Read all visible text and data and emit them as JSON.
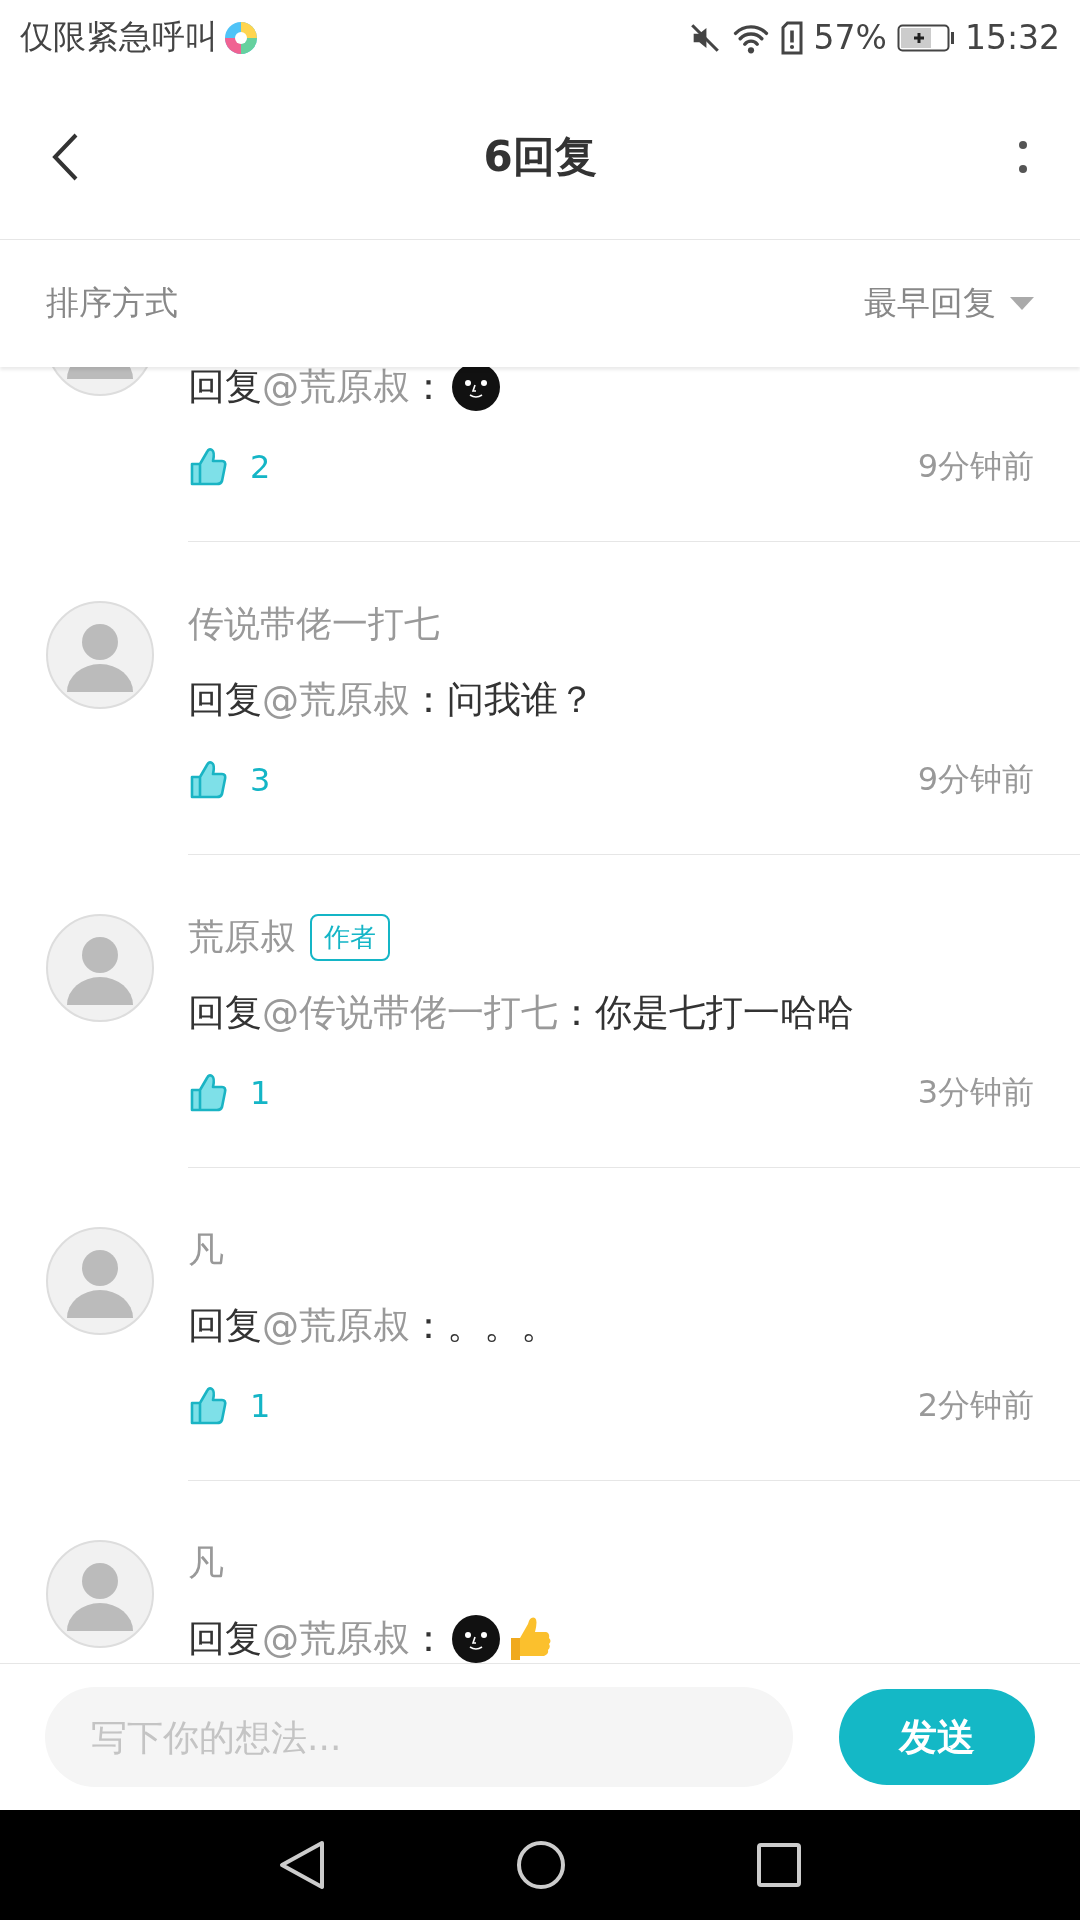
{
  "status_bar": {
    "carrier": "仅限紧急呼叫",
    "battery": "57%",
    "time": "15:32"
  },
  "header": {
    "title": "6回复"
  },
  "sort_bar": {
    "label": "排序方式",
    "value": "最早回复"
  },
  "comments": [
    {
      "prefix": "回复",
      "mention": "@荒原叔",
      "separator": "：",
      "emojis": [
        {
          "kind": "face"
        }
      ],
      "likes": "2",
      "time": "9分钟前"
    },
    {
      "author": "传说带佬一打七",
      "prefix": "回复",
      "mention": "@荒原叔",
      "separator": "：",
      "text": "问我谁？",
      "likes": "3",
      "time": "9分钟前"
    },
    {
      "author": "荒原叔",
      "badge": "作者",
      "prefix": "回复",
      "mention": "@传说带佬一打七",
      "separator": "：",
      "text": "你是七打一哈哈",
      "likes": "1",
      "time": "3分钟前"
    },
    {
      "author": "凡",
      "prefix": "回复",
      "mention": "@荒原叔",
      "separator": "：",
      "text": "。。。",
      "likes": "1",
      "time": "2分钟前"
    },
    {
      "author": "凡",
      "prefix": "回复",
      "mention": "@荒原叔",
      "separator": "：",
      "emojis": [
        {
          "kind": "face"
        },
        {
          "kind": "thumbs-up"
        }
      ]
    }
  ],
  "composer": {
    "placeholder": "写下你的想法...",
    "send": "发送"
  }
}
